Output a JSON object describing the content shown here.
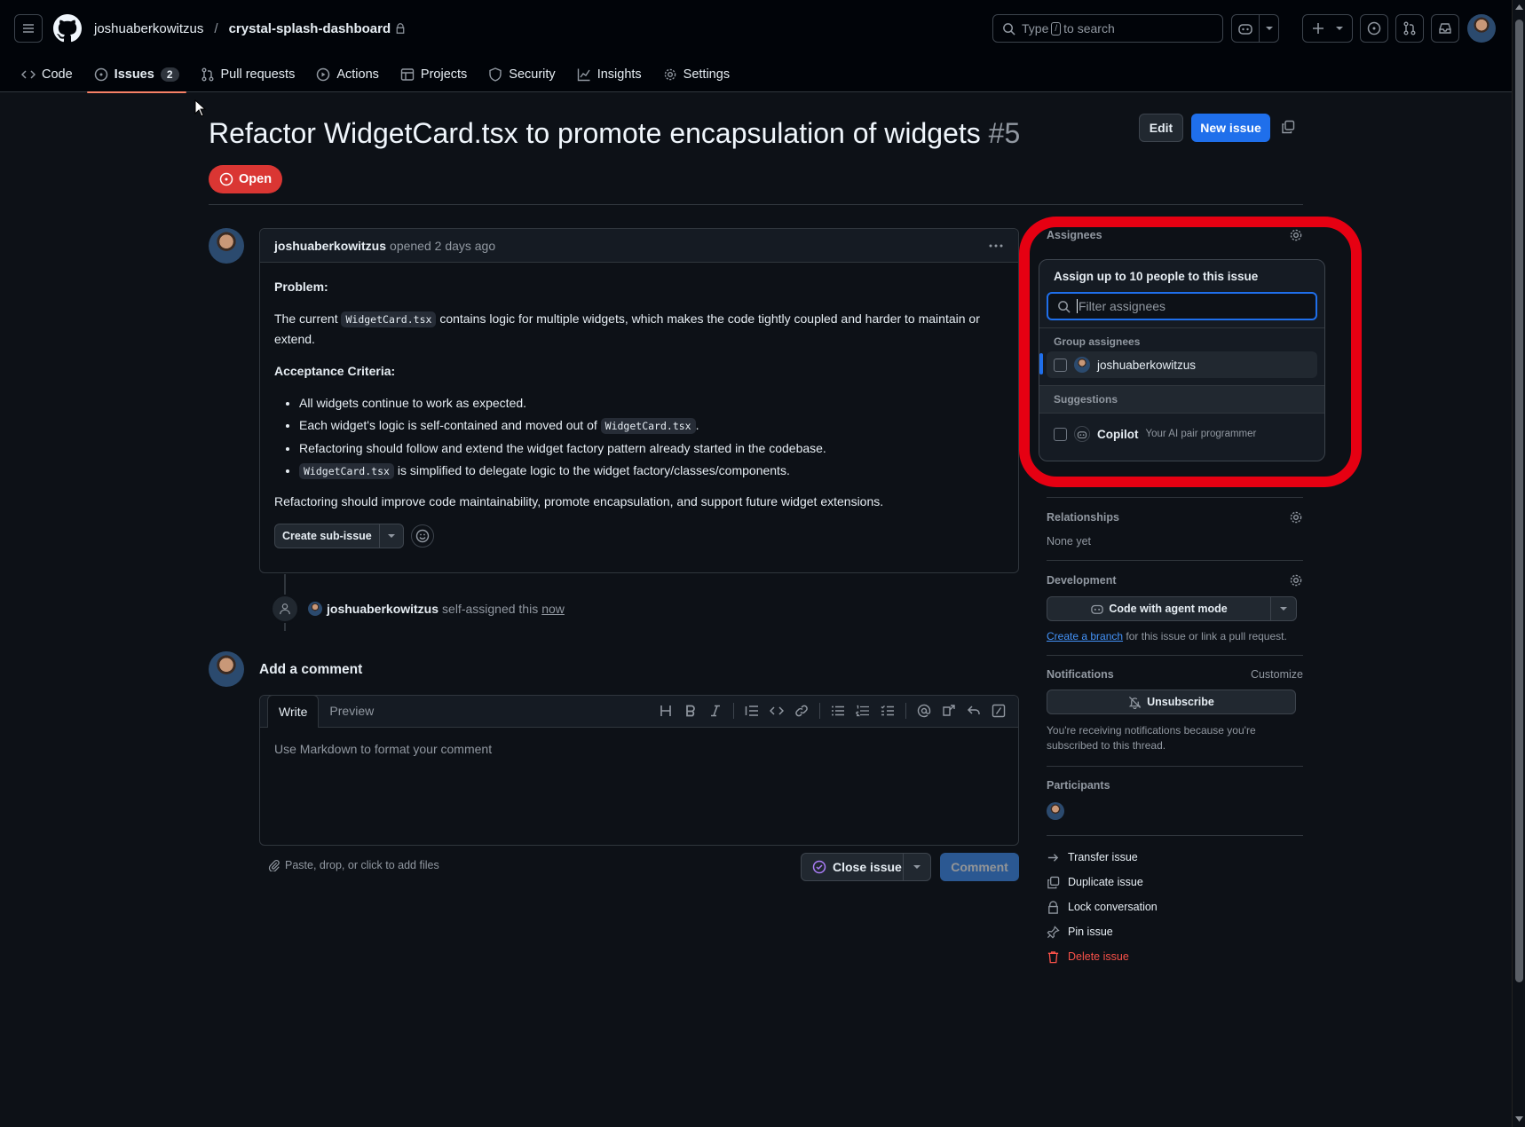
{
  "header": {
    "owner": "joshuaberkowitzus",
    "separator": "/",
    "repo": "crystal-splash-dashboard",
    "search_prefix": "Type",
    "search_key": "/",
    "search_suffix": "to search"
  },
  "nav": {
    "code": "Code",
    "issues": "Issues",
    "issues_count": "2",
    "pulls": "Pull requests",
    "actions": "Actions",
    "projects": "Projects",
    "security": "Security",
    "insights": "Insights",
    "settings": "Settings"
  },
  "issue": {
    "title": "Refactor WidgetCard.tsx to promote encapsulation of widgets",
    "number": "#5",
    "state": "Open",
    "edit_label": "Edit",
    "new_issue_label": "New issue"
  },
  "comment": {
    "author": "joshuaberkowitzus",
    "meta": "opened 2 days ago",
    "problem_heading": "Problem:",
    "problem_pre": "The current",
    "problem_code": "WidgetCard.tsx",
    "problem_post": "contains logic for multiple widgets, which makes the code tightly coupled and harder to maintain or extend.",
    "criteria_heading": "Acceptance Criteria:",
    "criteria_1": "All widgets continue to work as expected.",
    "criteria_2_pre": "Each widget's logic is self-contained and moved out of",
    "criteria_2_code": "WidgetCard.tsx",
    "criteria_2_post": ".",
    "criteria_3": "Refactoring should follow and extend the widget factory pattern already started in the codebase.",
    "criteria_4_code": "WidgetCard.tsx",
    "criteria_4_post": "is simplified to delegate logic to the widget factory/classes/components.",
    "closing": "Refactoring should improve code maintainability, promote encapsulation, and support future widget extensions.",
    "sub_issue_label": "Create sub-issue"
  },
  "timeline": {
    "actor": "joshuaberkowitzus",
    "action": "self-assigned this",
    "time": "now"
  },
  "add_comment": {
    "heading": "Add a comment",
    "tab_write": "Write",
    "tab_preview": "Preview",
    "placeholder": "Use Markdown to format your comment",
    "attach_hint": "Paste, drop, or click to add files",
    "close_label": "Close issue",
    "comment_label": "Comment"
  },
  "sidebar": {
    "assignees_label": "Assignees",
    "popup": {
      "title": "Assign up to 10 people to this issue",
      "filter_placeholder": "Filter assignees",
      "group_label": "Group assignees",
      "group_user": "joshuaberkowitzus",
      "suggestions_label": "Suggestions",
      "copilot_name": "Copilot",
      "copilot_desc": "Your AI pair programmer"
    },
    "relationships_label": "Relationships",
    "relationships_value": "None yet",
    "development_label": "Development",
    "agent_mode_label": "Code with agent mode",
    "create_branch_link": "Create a branch",
    "create_branch_rest": "for this issue or link a pull request.",
    "notifications_label": "Notifications",
    "customize_label": "Customize",
    "unsubscribe_label": "Unsubscribe",
    "notif_reason": "You're receiving notifications because you're subscribed to this thread.",
    "participants_label": "Participants",
    "transfer": "Transfer issue",
    "duplicate": "Duplicate issue",
    "lock": "Lock conversation",
    "pin": "Pin issue",
    "delete": "Delete issue"
  },
  "colors": {
    "accent_blue": "#1f6feb",
    "open_red": "#da3633",
    "highlight_red": "#e60012",
    "danger_text": "#f85149"
  }
}
